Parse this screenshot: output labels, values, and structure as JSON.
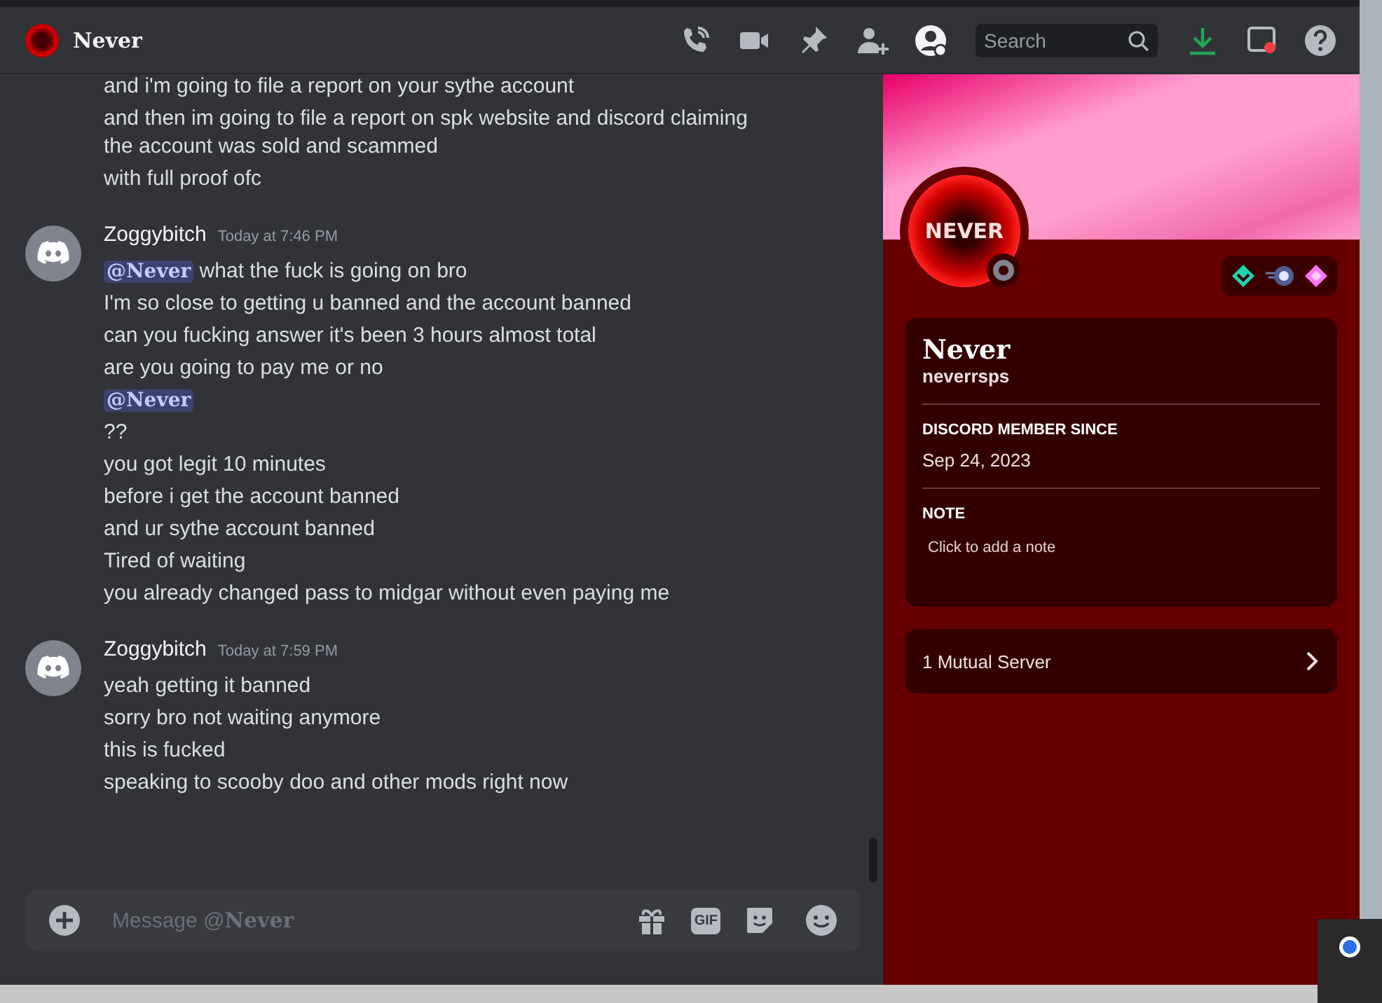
{
  "header": {
    "title": "Never",
    "search": {
      "placeholder": "Search"
    }
  },
  "messages": [
    {
      "lines": [
        {
          "kind": "text",
          "text": "and i'm going to file a report on your sythe account"
        },
        {
          "kind": "text",
          "text": "and then im going to file a report on spk website and discord claiming the account was sold and scammed"
        },
        {
          "kind": "text",
          "text": "with full proof ofc"
        }
      ]
    },
    {
      "author": "Zoggybitch",
      "time": "Today at 7:46 PM",
      "lines": [
        {
          "kind": "mention",
          "mention": "@Never",
          "text": "what the fuck is going on bro"
        },
        {
          "kind": "text",
          "text": "I'm so close to getting u banned and the account banned"
        },
        {
          "kind": "text",
          "text": "can you fucking answer it's been 3 hours almost total"
        },
        {
          "kind": "text",
          "text": "are you going to pay me or no"
        },
        {
          "kind": "mention",
          "mention": "@Never"
        },
        {
          "kind": "text",
          "text": "??"
        },
        {
          "kind": "text",
          "text": "you got legit 10 minutes"
        },
        {
          "kind": "text",
          "text": "before i get the account banned"
        },
        {
          "kind": "text",
          "text": "and ur sythe account banned"
        },
        {
          "kind": "text",
          "text": "Tired of waiting"
        },
        {
          "kind": "text",
          "text": "you already changed pass to midgar without even paying me"
        }
      ]
    },
    {
      "author": "Zoggybitch",
      "time": "Today at 7:59 PM",
      "lines": [
        {
          "kind": "text",
          "text": "yeah getting it banned"
        },
        {
          "kind": "text",
          "text": "sorry bro not waiting anymore"
        },
        {
          "kind": "text",
          "text": "this is fucked"
        },
        {
          "kind": "text",
          "text": "speaking to scooby doo and other mods right now"
        }
      ]
    }
  ],
  "composer": {
    "placeholder_prefix": "Message @",
    "placeholder_name": "Never",
    "gif_label": "GIF"
  },
  "profile": {
    "avatar_text": "NEVER",
    "display_name": "Never",
    "username": "neverrsps",
    "member_since_label": "DISCORD MEMBER SINCE",
    "member_since": "Sep 24, 2023",
    "note_label": "NOTE",
    "note_placeholder": "Click to add a note",
    "mutual_servers": "1 Mutual Server"
  }
}
